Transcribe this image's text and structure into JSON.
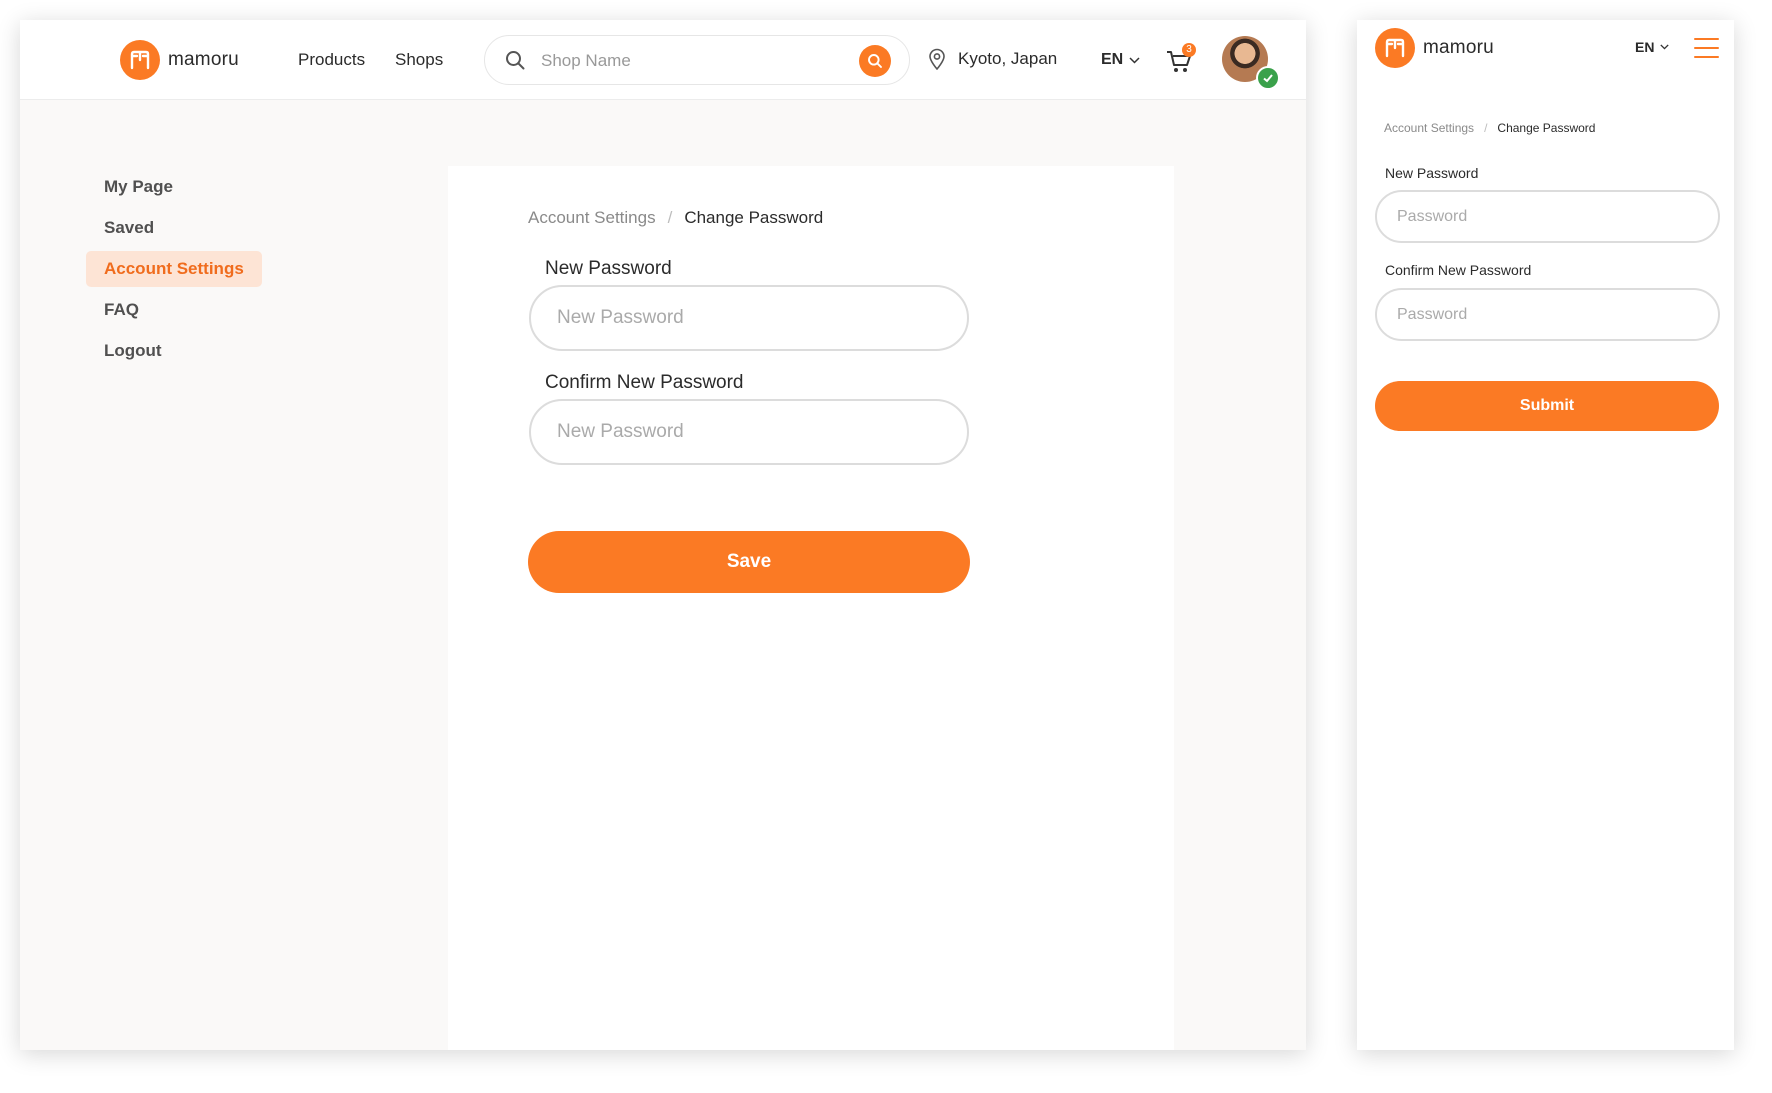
{
  "brand": {
    "name": "mamoru",
    "accent": "#fb7a24"
  },
  "desktop": {
    "nav": {
      "products": "Products",
      "shops": "Shops"
    },
    "search": {
      "placeholder": "Shop Name"
    },
    "location": "Kyoto, Japan",
    "language": "EN",
    "cart_count": "3",
    "sidebar": {
      "items": [
        {
          "label": "My Page",
          "active": false
        },
        {
          "label": "Saved",
          "active": false
        },
        {
          "label": "Account Settings",
          "active": true
        },
        {
          "label": "FAQ",
          "active": false
        },
        {
          "label": "Logout",
          "active": false
        }
      ]
    },
    "breadcrumb": {
      "parent": "Account Settings",
      "separator": "/",
      "current": "Change Password"
    },
    "form": {
      "new_password_label": "New Password",
      "new_password_placeholder": "New Password",
      "confirm_password_label": "Confirm New Password",
      "confirm_password_placeholder": "New Password",
      "save_label": "Save"
    }
  },
  "mobile": {
    "language": "EN",
    "breadcrumb": {
      "parent": "Account Settings",
      "separator": "/",
      "current": "Change Password"
    },
    "form": {
      "new_password_label": "New Password",
      "new_password_placeholder": "Password",
      "confirm_password_label": "Confirm New Password",
      "confirm_password_placeholder": "Password",
      "submit_label": "Submit"
    }
  },
  "icons": {
    "logo": "mamoru-logo-icon",
    "search": "search-icon",
    "location": "map-pin-icon",
    "cart": "cart-icon",
    "verified": "check-circle-icon",
    "menu": "hamburger-menu-icon",
    "chevron": "chevron-down-icon"
  }
}
